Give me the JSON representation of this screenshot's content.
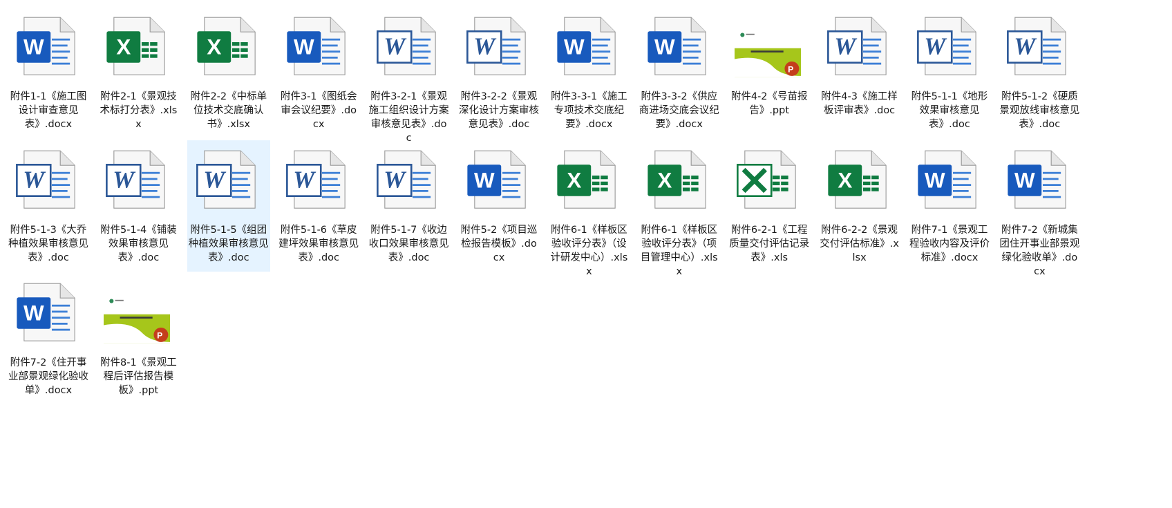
{
  "colors": {
    "word_blue": "#185abd",
    "word_classic_blue": "#2b5797",
    "excel_green": "#107c41",
    "ppt_orange": "#c43e1c",
    "selection": "#e5f3ff"
  },
  "files": [
    {
      "label": "附件1-1《施工图设计审查意见表》.docx",
      "icon": "word-docx"
    },
    {
      "label": "附件2-1《景观技术标打分表》.xlsx",
      "icon": "excel-xlsx"
    },
    {
      "label": "附件2-2《中标单位技术交底确认书》.xlsx",
      "icon": "excel-xlsx"
    },
    {
      "label": "附件3-1《图纸会审会议纪要》.docx",
      "icon": "word-docx"
    },
    {
      "label": "附件3-2-1《景观施工组织设计方案审核意见表》.doc",
      "icon": "word-doc"
    },
    {
      "label": "附件3-2-2《景观深化设计方案审核意见表》.doc",
      "icon": "word-doc"
    },
    {
      "label": "附件3-3-1《施工专项技术交底纪要》.docx",
      "icon": "word-docx"
    },
    {
      "label": "附件3-3-2《供应商进场交底会议纪要》.docx",
      "icon": "word-docx"
    },
    {
      "label": "附件4-2《号苗报告》.ppt",
      "icon": "ppt-thumbnail"
    },
    {
      "label": "附件4-3《施工样板评审表》.doc",
      "icon": "word-doc"
    },
    {
      "label": "附件5-1-1《地形效果审核意见表》.doc",
      "icon": "word-doc"
    },
    {
      "label": "附件5-1-2《硬质景观放线审核意见表》.doc",
      "icon": "word-doc"
    },
    {
      "label": "附件5-1-3《大乔种植效果审核意见表》.doc",
      "icon": "word-doc"
    },
    {
      "label": "附件5-1-4《铺装效果审核意见表》.doc",
      "icon": "word-doc"
    },
    {
      "label": "附件5-1-5《组团种植效果审核意见表》.doc",
      "icon": "word-doc",
      "selected": true
    },
    {
      "label": "附件5-1-6《草皮建坪效果审核意见表》.doc",
      "icon": "word-doc"
    },
    {
      "label": "附件5-1-7《收边收口效果审核意见表》.doc",
      "icon": "word-doc"
    },
    {
      "label": "附件5-2《项目巡检报告模板》.docx",
      "icon": "word-docx"
    },
    {
      "label": "附件6-1《样板区验收评分表》（设计研发中心）.xlsx",
      "icon": "excel-xlsx"
    },
    {
      "label": "附件6-1《样板区验收评分表》（项目管理中心）.xlsx",
      "icon": "excel-xlsx"
    },
    {
      "label": "附件6-2-1《工程质量交付评估记录表》.xls",
      "icon": "excel-xls"
    },
    {
      "label": "附件6-2-2《景观交付评估标准》.xlsx",
      "icon": "excel-xlsx"
    },
    {
      "label": "附件7-1《景观工程验收内容及评价标准》.docx",
      "icon": "word-docx"
    },
    {
      "label": "附件7-2《新城集团住开事业部景观绿化验收单》.docx",
      "icon": "word-docx"
    },
    {
      "label": "附件7-2《住开事业部景观绿化验收单》.docx",
      "icon": "word-docx"
    },
    {
      "label": "附件8-1《景观工程后评估报告模板》.ppt",
      "icon": "ppt-thumbnail"
    }
  ]
}
